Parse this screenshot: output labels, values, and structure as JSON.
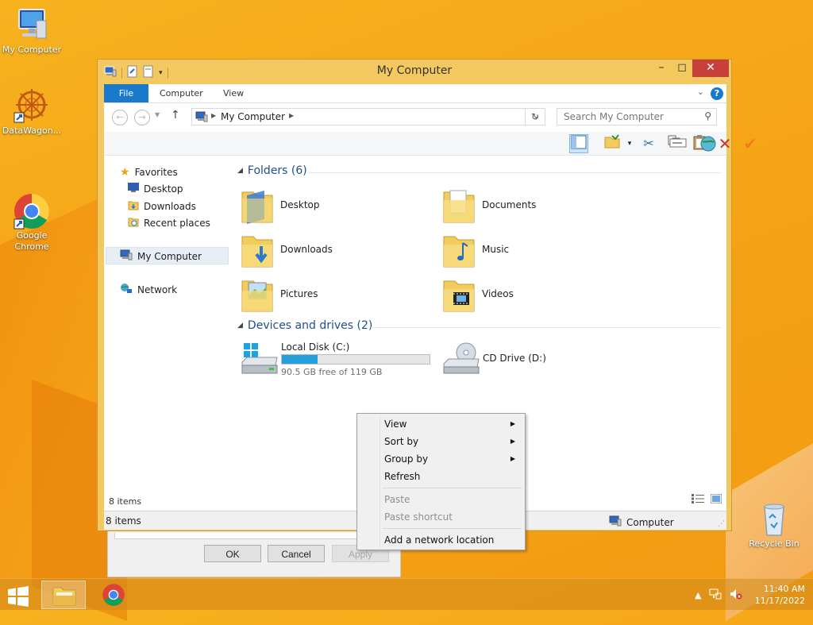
{
  "desktop": {
    "icons": [
      {
        "label": "My Computer"
      },
      {
        "label": "DataWagon..."
      },
      {
        "label": "Google\nChrome"
      },
      {
        "label": "Recycle Bin"
      }
    ]
  },
  "window": {
    "title": "My Computer",
    "ribbon_tabs": [
      "File",
      "Computer",
      "View"
    ],
    "help": "?",
    "address": "My Computer",
    "search_placeholder": "Search My Computer",
    "nav": {
      "favorites": "Favorites",
      "desktop": "Desktop",
      "downloads": "Downloads",
      "recent": "Recent places",
      "mycomputer": "My Computer",
      "network": "Network"
    },
    "groups": {
      "folders": "Folders (6)",
      "devices": "Devices and drives (2)"
    },
    "folders": [
      {
        "label": "Desktop"
      },
      {
        "label": "Documents"
      },
      {
        "label": "Downloads"
      },
      {
        "label": "Music"
      },
      {
        "label": "Pictures"
      },
      {
        "label": "Videos"
      }
    ],
    "drives": [
      {
        "label": "Local Disk (C:)",
        "free_text": "90.5 GB free of 119 GB",
        "used_fraction": 0.24
      },
      {
        "label": "CD Drive (D:)"
      }
    ],
    "items_inner": "8 items",
    "status_left": "8 items",
    "status_right": "Computer"
  },
  "dialog": {
    "ok": "OK",
    "cancel": "Cancel",
    "apply": "Apply"
  },
  "context_menu": {
    "items": [
      {
        "label": "View",
        "submenu": true
      },
      {
        "label": "Sort by",
        "submenu": true
      },
      {
        "label": "Group by",
        "submenu": true
      },
      {
        "label": "Refresh"
      },
      {
        "label": "Paste",
        "disabled": true
      },
      {
        "label": "Paste shortcut",
        "disabled": true
      },
      {
        "label": "Add a network location"
      }
    ]
  },
  "taskbar": {
    "time": "11:40 AM",
    "date": "11/17/2022"
  },
  "colors": {
    "accent": "#1979ca",
    "window_frame": "#f3c95f",
    "progress": "#26a0da"
  }
}
